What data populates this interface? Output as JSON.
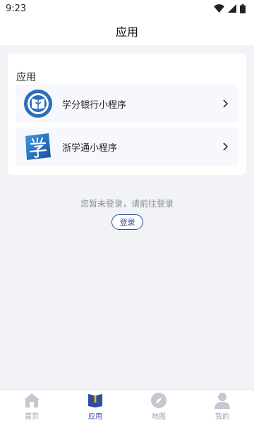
{
  "status_bar": {
    "time": "9:23"
  },
  "header": {
    "title": "应用"
  },
  "card": {
    "title": "应用",
    "items": [
      {
        "label": "学分银行小程序",
        "icon": "credit-bank-logo-icon"
      },
      {
        "label": "浙学通小程序",
        "icon": "zhexuetong-logo-icon"
      }
    ]
  },
  "login": {
    "tip": "您暂未登录，请前往登录",
    "button_label": "登录"
  },
  "tabs": [
    {
      "label": "首页",
      "icon": "home-icon",
      "active": false
    },
    {
      "label": "应用",
      "icon": "book-icon",
      "active": true
    },
    {
      "label": "地图",
      "icon": "compass-icon",
      "active": false
    },
    {
      "label": "我的",
      "icon": "user-icon",
      "active": false
    }
  ],
  "colors": {
    "accent": "#2f4ea0",
    "inactive": "#9aa0aa",
    "background": "#f2f3f7"
  }
}
